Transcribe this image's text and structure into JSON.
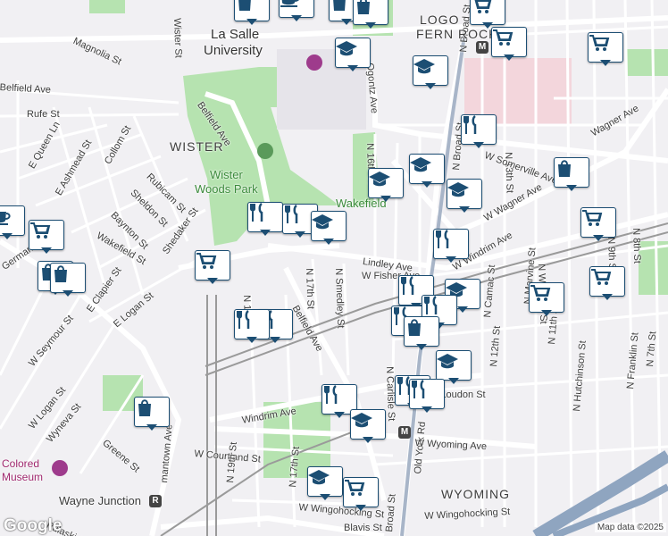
{
  "map": {
    "labels": {
      "wister_st": "Wister St",
      "magnolia_st": "Magnolia St",
      "belfield_ave_w": "Belfield Ave",
      "rufe_st": "Rufe St",
      "belfield_ave_n": "Belfield Ave",
      "wister": "WISTER",
      "e_queen_ln": "E Queen Ln",
      "collom_st": "Collom St",
      "e_ashmead_st": "E Ashmead St",
      "rubicam_st": "Rubicam St",
      "sheldon_st": "Sheldon St",
      "baynton_st": "Baynton St",
      "wakefield_st": "Wakefield St",
      "shedaker_st": "Shedaker St",
      "e_clapier_st": "E Clapier St",
      "e_logan_st": "E Logan St",
      "germantown": "Germanto",
      "w_seymour_st": "W Seymour St",
      "w_logan_st": "W Logan St",
      "wyneva_st": "Wyneva St",
      "greene_st": "Greene St",
      "germantown_ave": "mantown Ave",
      "ogontz_ave": "Ogontz Ave",
      "n_16th_st": "N 16th St",
      "wakefield": "Wakefield",
      "n_broad_st": "N Broad St",
      "old_york_rd_n": "Old York Rd",
      "n_13th_st": "N 13th St",
      "w_somerville_ave": "W Somerville Ave",
      "wagner_ave": "Wagner Ave",
      "w_wagner_ave": "W Wagner Ave",
      "w_windrim_ave": "W Windrim Ave",
      "lindley_ave": "Lindley Ave",
      "w_fisher_ave": "W Fisher Ave",
      "n_17th_st": "N 17th St",
      "n_smedley_st": "N Smedley St",
      "n_19th_st": "N 19th St",
      "belfield_ave_s": "Belfield Ave",
      "n_carlisle_st": "N Carlisle St",
      "old_york_rd_s": "Old York Rd",
      "n_camac_st": "N Camac St",
      "n_12th_st": "N 12th St",
      "n_marvine_st": "N Marvine St",
      "n_warnock_st": "N Warnock St",
      "n_11th_st": "N 11th St",
      "n_hutchinson_st": "N Hutchinson St",
      "n_franklin_st": "N Franklin St",
      "n_7th_st": "N 7th St",
      "n_9th_st": "N 9th St",
      "n_8th_st": "N 8th St",
      "w_loudon_st": "W Loudon St",
      "windrim_ave": "Windrim Ave",
      "w_wyoming_ave": "W Wyoming Ave",
      "wyoming_ave_w": "W Wyoming Ave",
      "w_courtland_st": "W Courtland St",
      "wyoming": "WYOMING",
      "wayne_junction": "Wayne Junction",
      "w_wingohocking_st": "W Wingohocking St",
      "w_wingohocking_st_2": "W Wingohocking St",
      "blavis_st": "Blavis St",
      "pulaski_ave": "Pulaski Ave",
      "la_salle": "La Salle",
      "university": "University",
      "wister_woods": "Wister",
      "woods_park": "Woods Park",
      "colored": "Colored",
      "museum": "Museum",
      "lindley_st_frag": "St",
      "logan_st_frag": "n St",
      "fern_rock": "FERN ROCK",
      "logan_top": "LOGO",
      "lalogan": "LA",
      "camac_top": "N Camac St",
      "n_12th_top": "N 12th St",
      "n_10th_top": "N 10th St",
      "lindley_frag": "ley Ave",
      "w_frag": "W O",
      "n_20th": "N 20th St",
      "n_19th_top": "N 19th St",
      "broad_st_s": "Broad St",
      "n_17th_s": "N 17th St",
      "n_19th_s": "N 19th St",
      "ark_frag": "ark",
      "n_10th_s": "N 10th St"
    },
    "pins": [
      {
        "kind": "shopping",
        "label": "shopping-pin"
      },
      {
        "kind": "cafe",
        "label": "cafe-pin"
      },
      {
        "kind": "shopping",
        "label": "shopping-pin"
      },
      {
        "kind": "shopping",
        "label": "shopping-pin"
      },
      {
        "kind": "grocery",
        "label": "grocery-pin"
      },
      {
        "kind": "grocery",
        "label": "grocery-pin"
      },
      {
        "kind": "grocery",
        "label": "grocery-pin"
      },
      {
        "kind": "school",
        "label": "school-pin"
      },
      {
        "kind": "school",
        "label": "school-pin"
      },
      {
        "kind": "restaurant",
        "label": "restaurant-pin"
      },
      {
        "kind": "school",
        "label": "school-pin"
      },
      {
        "kind": "school",
        "label": "school-pin"
      },
      {
        "kind": "shopping",
        "label": "shopping-pin"
      },
      {
        "kind": "school",
        "label": "school-pin"
      },
      {
        "kind": "restaurant",
        "label": "restaurant-pin"
      },
      {
        "kind": "restaurant",
        "label": "restaurant-pin"
      },
      {
        "kind": "school",
        "label": "school-pin"
      },
      {
        "kind": "grocery",
        "label": "grocery-pin"
      },
      {
        "kind": "cafe",
        "label": "cafe-pin"
      },
      {
        "kind": "grocery",
        "label": "grocery-pin"
      },
      {
        "kind": "shopping",
        "label": "shopping-pin"
      },
      {
        "kind": "shopping",
        "label": "shopping-pin"
      },
      {
        "kind": "grocery",
        "label": "grocery-pin"
      },
      {
        "kind": "restaurant",
        "label": "restaurant-pin"
      },
      {
        "kind": "restaurant",
        "label": "restaurant-pin"
      },
      {
        "kind": "school",
        "label": "school-pin"
      },
      {
        "kind": "restaurant",
        "label": "restaurant-pin"
      },
      {
        "kind": "restaurant",
        "label": "restaurant-pin"
      },
      {
        "kind": "restaurant",
        "label": "restaurant-pin"
      },
      {
        "kind": "shopping",
        "label": "shopping-pin"
      },
      {
        "kind": "grocery",
        "label": "grocery-pin"
      },
      {
        "kind": "grocery",
        "label": "grocery-pin"
      },
      {
        "kind": "school",
        "label": "school-pin"
      },
      {
        "kind": "restaurant",
        "label": "restaurant-pin"
      },
      {
        "kind": "restaurant",
        "label": "restaurant-pin"
      },
      {
        "kind": "school",
        "label": "school-pin"
      },
      {
        "kind": "shopping",
        "label": "shopping-pin"
      },
      {
        "kind": "restaurant",
        "label": "restaurant-pin"
      },
      {
        "kind": "school",
        "label": "school-pin"
      },
      {
        "kind": "grocery",
        "label": "grocery-pin"
      },
      {
        "kind": "restaurant",
        "label": "restaurant-pin"
      }
    ],
    "stations": {
      "broad_top": "M",
      "wyoming": "M",
      "wayne": "R"
    },
    "google_logo": "Google",
    "attribution": "Map data ©2025",
    "colors": {
      "background": "#f1f0f3",
      "park": "#b6e3b0",
      "road": "#ffffff",
      "highway": "#8fa5c0",
      "campus": "#f3d6dc",
      "pin_border": "#1c4e73",
      "rail": "#9a9a9a"
    }
  }
}
